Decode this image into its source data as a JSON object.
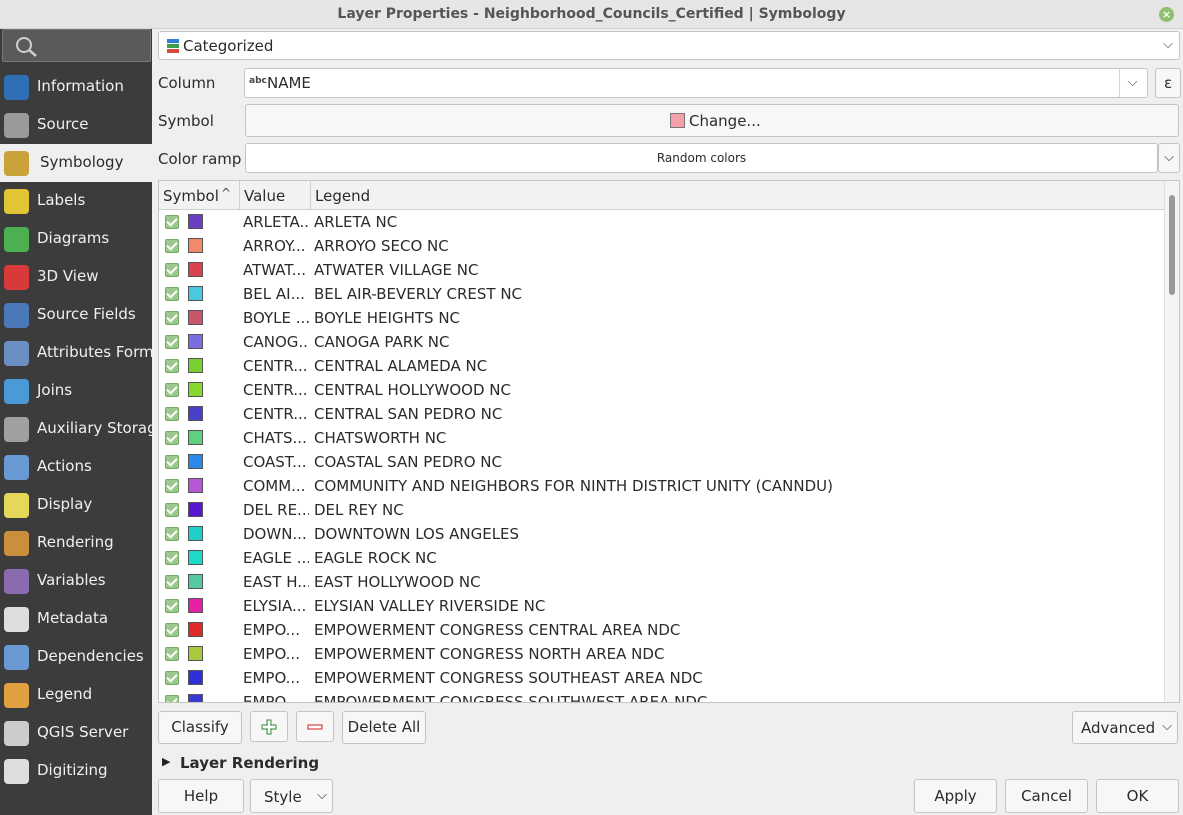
{
  "window": {
    "title": "Layer Properties - Neighborhood_Councils_Certified | Symbology"
  },
  "sidebar": {
    "items": [
      {
        "label": "Information",
        "icon": "info-icon",
        "color": "#2f6fb6"
      },
      {
        "label": "Source",
        "icon": "source-icon",
        "color": "#9a9a9a"
      },
      {
        "label": "Symbology",
        "icon": "brush-icon",
        "color": "#c9a23a",
        "active": true
      },
      {
        "label": "Labels",
        "icon": "labels-icon",
        "color": "#e2c534"
      },
      {
        "label": "Diagrams",
        "icon": "diagrams-icon",
        "color": "#4caf50"
      },
      {
        "label": "3D View",
        "icon": "cube-icon",
        "color": "#d83a3a"
      },
      {
        "label": "Source Fields",
        "icon": "fields-icon",
        "color": "#4a78b8"
      },
      {
        "label": "Attributes Form",
        "icon": "form-icon",
        "color": "#6b8fc2"
      },
      {
        "label": "Joins",
        "icon": "joins-icon",
        "color": "#4a9ad8"
      },
      {
        "label": "Auxiliary Storage",
        "icon": "storage-icon",
        "color": "#a0a0a0"
      },
      {
        "label": "Actions",
        "icon": "actions-icon",
        "color": "#6a9ad4"
      },
      {
        "label": "Display",
        "icon": "display-icon",
        "color": "#e6d65a"
      },
      {
        "label": "Rendering",
        "icon": "rendering-icon",
        "color": "#c98f3a"
      },
      {
        "label": "Variables",
        "icon": "variables-icon",
        "color": "#8a6bb0"
      },
      {
        "label": "Metadata",
        "icon": "metadata-icon",
        "color": "#dddddd"
      },
      {
        "label": "Dependencies",
        "icon": "dependencies-icon",
        "color": "#6a9ad4"
      },
      {
        "label": "Legend",
        "icon": "legend-icon",
        "color": "#e0a040"
      },
      {
        "label": "QGIS Server",
        "icon": "server-icon",
        "color": "#cccccc"
      },
      {
        "label": "Digitizing",
        "icon": "digitizing-icon",
        "color": "#dddddd"
      }
    ]
  },
  "renderer": {
    "type_label": "Categorized",
    "icon": "categorized-icon"
  },
  "column": {
    "label": "Column",
    "type_badge": "abc",
    "value": "NAME",
    "expression_glyph": "ε"
  },
  "symbol": {
    "label": "Symbol",
    "button_label": "Change...",
    "swatch_color": "#f4a0aa"
  },
  "color_ramp": {
    "label": "Color ramp",
    "value": "Random colors"
  },
  "table": {
    "headers": {
      "symbol": "Symbol",
      "value": "Value",
      "legend": "Legend"
    },
    "rows": [
      {
        "value": "ARLETA...",
        "legend": "ARLETA NC",
        "color": "#6a3fc2"
      },
      {
        "value": "ARROY...",
        "legend": "ARROYO SECO NC",
        "color": "#f28a6a"
      },
      {
        "value": "ATWAT...",
        "legend": "ATWATER VILLAGE NC",
        "color": "#d8434f"
      },
      {
        "value": "BEL AI...",
        "legend": "BEL AIR-BEVERLY CREST NC",
        "color": "#4ac8e0"
      },
      {
        "value": "BOYLE ...",
        "legend": "BOYLE HEIGHTS NC",
        "color": "#c9566a"
      },
      {
        "value": "CANOG...",
        "legend": "CANOGA PARK NC",
        "color": "#7a6ee0"
      },
      {
        "value": "CENTR...",
        "legend": "CENTRAL ALAMEDA NC",
        "color": "#7ad030"
      },
      {
        "value": "CENTR...",
        "legend": "CENTRAL HOLLYWOOD NC",
        "color": "#86d830"
      },
      {
        "value": "CENTR...",
        "legend": "CENTRAL SAN PEDRO NC",
        "color": "#4840c8"
      },
      {
        "value": "CHATS...",
        "legend": "CHATSWORTH NC",
        "color": "#5ed080"
      },
      {
        "value": "COAST...",
        "legend": "COASTAL SAN PEDRO NC",
        "color": "#2a8ae8"
      },
      {
        "value": "COMM...",
        "legend": "COMMUNITY AND NEIGHBORS FOR NINTH DISTRICT UNITY (CANNDU)",
        "color": "#b458d8"
      },
      {
        "value": "DEL RE...",
        "legend": "DEL REY NC",
        "color": "#5a18d0"
      },
      {
        "value": "DOWN...",
        "legend": "DOWNTOWN LOS ANGELES",
        "color": "#20d0c8"
      },
      {
        "value": "EAGLE ...",
        "legend": "EAGLE ROCK NC",
        "color": "#1ed8c8"
      },
      {
        "value": "EAST H...",
        "legend": "EAST HOLLYWOOD NC",
        "color": "#58c8a0"
      },
      {
        "value": "ELYSIA...",
        "legend": "ELYSIAN VALLEY RIVERSIDE NC",
        "color": "#e820a8"
      },
      {
        "value": "EMPO...",
        "legend": "EMPOWERMENT CONGRESS CENTRAL AREA NDC",
        "color": "#e02a2a"
      },
      {
        "value": "EMPO...",
        "legend": "EMPOWERMENT CONGRESS NORTH AREA NDC",
        "color": "#a8c840"
      },
      {
        "value": "EMPO...",
        "legend": "EMPOWERMENT CONGRESS SOUTHEAST AREA NDC",
        "color": "#3030d8"
      },
      {
        "value": "EMPO...",
        "legend": "EMPOWERMENT CONGRESS SOUTHWEST AREA NDC",
        "color": "#3a3ad0"
      }
    ]
  },
  "actions": {
    "classify": "Classify",
    "delete_all": "Delete All",
    "advanced": "Advanced"
  },
  "layer_rendering": {
    "label": "Layer Rendering"
  },
  "footer": {
    "help": "Help",
    "style": "Style",
    "apply": "Apply",
    "cancel": "Cancel",
    "ok": "OK"
  }
}
